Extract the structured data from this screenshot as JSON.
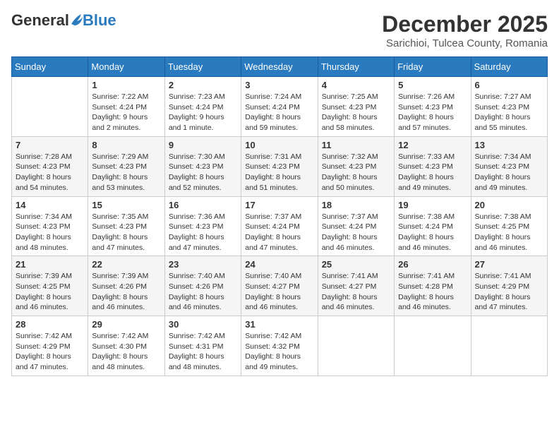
{
  "header": {
    "logo_general": "General",
    "logo_blue": "Blue",
    "month_title": "December 2025",
    "location": "Sarichioi, Tulcea County, Romania"
  },
  "weekdays": [
    "Sunday",
    "Monday",
    "Tuesday",
    "Wednesday",
    "Thursday",
    "Friday",
    "Saturday"
  ],
  "weeks": [
    [
      {
        "day": "",
        "info": ""
      },
      {
        "day": "1",
        "info": "Sunrise: 7:22 AM\nSunset: 4:24 PM\nDaylight: 9 hours and 2 minutes."
      },
      {
        "day": "2",
        "info": "Sunrise: 7:23 AM\nSunset: 4:24 PM\nDaylight: 9 hours and 1 minute."
      },
      {
        "day": "3",
        "info": "Sunrise: 7:24 AM\nSunset: 4:24 PM\nDaylight: 8 hours and 59 minutes."
      },
      {
        "day": "4",
        "info": "Sunrise: 7:25 AM\nSunset: 4:23 PM\nDaylight: 8 hours and 58 minutes."
      },
      {
        "day": "5",
        "info": "Sunrise: 7:26 AM\nSunset: 4:23 PM\nDaylight: 8 hours and 57 minutes."
      },
      {
        "day": "6",
        "info": "Sunrise: 7:27 AM\nSunset: 4:23 PM\nDaylight: 8 hours and 55 minutes."
      }
    ],
    [
      {
        "day": "7",
        "info": "Sunrise: 7:28 AM\nSunset: 4:23 PM\nDaylight: 8 hours and 54 minutes."
      },
      {
        "day": "8",
        "info": "Sunrise: 7:29 AM\nSunset: 4:23 PM\nDaylight: 8 hours and 53 minutes."
      },
      {
        "day": "9",
        "info": "Sunrise: 7:30 AM\nSunset: 4:23 PM\nDaylight: 8 hours and 52 minutes."
      },
      {
        "day": "10",
        "info": "Sunrise: 7:31 AM\nSunset: 4:23 PM\nDaylight: 8 hours and 51 minutes."
      },
      {
        "day": "11",
        "info": "Sunrise: 7:32 AM\nSunset: 4:23 PM\nDaylight: 8 hours and 50 minutes."
      },
      {
        "day": "12",
        "info": "Sunrise: 7:33 AM\nSunset: 4:23 PM\nDaylight: 8 hours and 49 minutes."
      },
      {
        "day": "13",
        "info": "Sunrise: 7:34 AM\nSunset: 4:23 PM\nDaylight: 8 hours and 49 minutes."
      }
    ],
    [
      {
        "day": "14",
        "info": "Sunrise: 7:34 AM\nSunset: 4:23 PM\nDaylight: 8 hours and 48 minutes."
      },
      {
        "day": "15",
        "info": "Sunrise: 7:35 AM\nSunset: 4:23 PM\nDaylight: 8 hours and 47 minutes."
      },
      {
        "day": "16",
        "info": "Sunrise: 7:36 AM\nSunset: 4:23 PM\nDaylight: 8 hours and 47 minutes."
      },
      {
        "day": "17",
        "info": "Sunrise: 7:37 AM\nSunset: 4:24 PM\nDaylight: 8 hours and 47 minutes."
      },
      {
        "day": "18",
        "info": "Sunrise: 7:37 AM\nSunset: 4:24 PM\nDaylight: 8 hours and 46 minutes."
      },
      {
        "day": "19",
        "info": "Sunrise: 7:38 AM\nSunset: 4:24 PM\nDaylight: 8 hours and 46 minutes."
      },
      {
        "day": "20",
        "info": "Sunrise: 7:38 AM\nSunset: 4:25 PM\nDaylight: 8 hours and 46 minutes."
      }
    ],
    [
      {
        "day": "21",
        "info": "Sunrise: 7:39 AM\nSunset: 4:25 PM\nDaylight: 8 hours and 46 minutes."
      },
      {
        "day": "22",
        "info": "Sunrise: 7:39 AM\nSunset: 4:26 PM\nDaylight: 8 hours and 46 minutes."
      },
      {
        "day": "23",
        "info": "Sunrise: 7:40 AM\nSunset: 4:26 PM\nDaylight: 8 hours and 46 minutes."
      },
      {
        "day": "24",
        "info": "Sunrise: 7:40 AM\nSunset: 4:27 PM\nDaylight: 8 hours and 46 minutes."
      },
      {
        "day": "25",
        "info": "Sunrise: 7:41 AM\nSunset: 4:27 PM\nDaylight: 8 hours and 46 minutes."
      },
      {
        "day": "26",
        "info": "Sunrise: 7:41 AM\nSunset: 4:28 PM\nDaylight: 8 hours and 46 minutes."
      },
      {
        "day": "27",
        "info": "Sunrise: 7:41 AM\nSunset: 4:29 PM\nDaylight: 8 hours and 47 minutes."
      }
    ],
    [
      {
        "day": "28",
        "info": "Sunrise: 7:42 AM\nSunset: 4:29 PM\nDaylight: 8 hours and 47 minutes."
      },
      {
        "day": "29",
        "info": "Sunrise: 7:42 AM\nSunset: 4:30 PM\nDaylight: 8 hours and 48 minutes."
      },
      {
        "day": "30",
        "info": "Sunrise: 7:42 AM\nSunset: 4:31 PM\nDaylight: 8 hours and 48 minutes."
      },
      {
        "day": "31",
        "info": "Sunrise: 7:42 AM\nSunset: 4:32 PM\nDaylight: 8 hours and 49 minutes."
      },
      {
        "day": "",
        "info": ""
      },
      {
        "day": "",
        "info": ""
      },
      {
        "day": "",
        "info": ""
      }
    ]
  ]
}
